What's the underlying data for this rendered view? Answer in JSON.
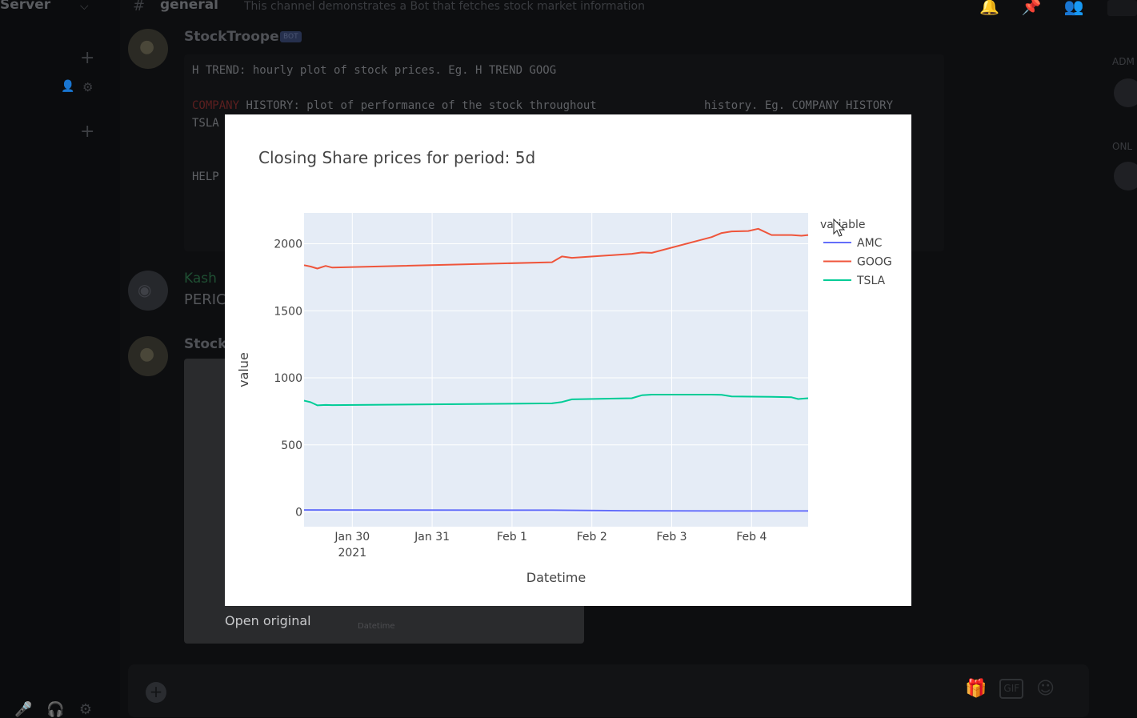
{
  "app": {
    "server_name": "Server",
    "channel_name": "general",
    "channel_topic": "This channel demonstrates a Bot that fetches stock market information",
    "bot_author": "StockTrooper",
    "bot_tag": "BOT",
    "code_lines": [
      "H TREND: hourly plot of stock prices. Eg. H TREND GOOG",
      "HISTORY: plot of performance of the stock throughout",
      "history. Eg. COMPANY HISTORY",
      "TSLA",
      "HELP"
    ],
    "second_author": "Kash",
    "second_message": "PERIC",
    "third_author": "StockT",
    "open_original": "Open original",
    "embed_xlabel": "Datetime",
    "right_labels": [
      "ADM",
      "ONL"
    ],
    "icons": {
      "dropdown": "chevron-down-icon",
      "bell": "bell-icon",
      "pin": "pin-icon",
      "members": "members-icon",
      "add": "plus-icon",
      "gift": "gift-icon",
      "gif": "GIF",
      "emoji": "emoji-icon"
    }
  },
  "chart_data": {
    "type": "line",
    "title": "Closing Share prices for period: 5d",
    "xlabel": "Datetime",
    "ylabel": "value",
    "legend_title": "variable",
    "legend_position": "right",
    "x_ticks": [
      {
        "date": "2021-01-30",
        "label": "Jan 30",
        "sublabel": "2021"
      },
      {
        "date": "2021-01-31",
        "label": "Jan 31",
        "sublabel": ""
      },
      {
        "date": "2021-02-01",
        "label": "Feb 1",
        "sublabel": ""
      },
      {
        "date": "2021-02-02",
        "label": "Feb 2",
        "sublabel": ""
      },
      {
        "date": "2021-02-03",
        "label": "Feb 3",
        "sublabel": ""
      },
      {
        "date": "2021-02-04",
        "label": "Feb 4",
        "sublabel": ""
      }
    ],
    "x_range": [
      "2021-01-29 09:30",
      "2021-02-04 17:00"
    ],
    "y_ticks": [
      0,
      500,
      1000,
      1500,
      2000
    ],
    "y_range": [
      -110,
      2230
    ],
    "grid": true,
    "series": [
      {
        "name": "AMC",
        "color": "#636efa",
        "points": [
          [
            "2021-01-29 09:30",
            15
          ],
          [
            "2021-01-30 12:00",
            14
          ],
          [
            "2021-02-01 12:00",
            13
          ],
          [
            "2021-02-02 09:30",
            9
          ],
          [
            "2021-02-03 12:00",
            7
          ],
          [
            "2021-02-04 17:00",
            7
          ]
        ]
      },
      {
        "name": "GOOG",
        "color": "#ef553b",
        "points": [
          [
            "2021-01-29 09:30",
            1840
          ],
          [
            "2021-01-29 11:30",
            1830
          ],
          [
            "2021-01-29 13:30",
            1815
          ],
          [
            "2021-01-29 16:00",
            1835
          ],
          [
            "2021-01-29 18:00",
            1822
          ],
          [
            "2021-02-01 12:00",
            1862
          ],
          [
            "2021-02-01 15:00",
            1905
          ],
          [
            "2021-02-01 18:00",
            1895
          ],
          [
            "2021-02-02 12:00",
            1925
          ],
          [
            "2021-02-02 15:00",
            1935
          ],
          [
            "2021-02-02 18:00",
            1932
          ],
          [
            "2021-02-03 12:00",
            2050
          ],
          [
            "2021-02-03 15:00",
            2080
          ],
          [
            "2021-02-03 18:00",
            2092
          ],
          [
            "2021-02-03 23:00",
            2095
          ],
          [
            "2021-02-04 02:00",
            2112
          ],
          [
            "2021-02-04 06:00",
            2065
          ],
          [
            "2021-02-04 12:00",
            2065
          ],
          [
            "2021-02-04 15:00",
            2060
          ],
          [
            "2021-02-04 17:00",
            2065
          ]
        ]
      },
      {
        "name": "TSLA",
        "color": "#00cc96",
        "points": [
          [
            "2021-01-29 09:30",
            830
          ],
          [
            "2021-01-29 11:30",
            818
          ],
          [
            "2021-01-29 13:30",
            795
          ],
          [
            "2021-01-29 16:00",
            798
          ],
          [
            "2021-01-29 18:00",
            797
          ],
          [
            "2021-02-01 12:00",
            810
          ],
          [
            "2021-02-01 15:00",
            820
          ],
          [
            "2021-02-01 18:00",
            840
          ],
          [
            "2021-02-02 12:00",
            848
          ],
          [
            "2021-02-02 15:00",
            870
          ],
          [
            "2021-02-02 18:00",
            875
          ],
          [
            "2021-02-03 12:00",
            875
          ],
          [
            "2021-02-03 15:00",
            873
          ],
          [
            "2021-02-03 18:00",
            862
          ],
          [
            "2021-02-04 06:00",
            858
          ],
          [
            "2021-02-04 12:00",
            855
          ],
          [
            "2021-02-04 14:00",
            842
          ],
          [
            "2021-02-04 17:00",
            848
          ]
        ]
      }
    ]
  }
}
